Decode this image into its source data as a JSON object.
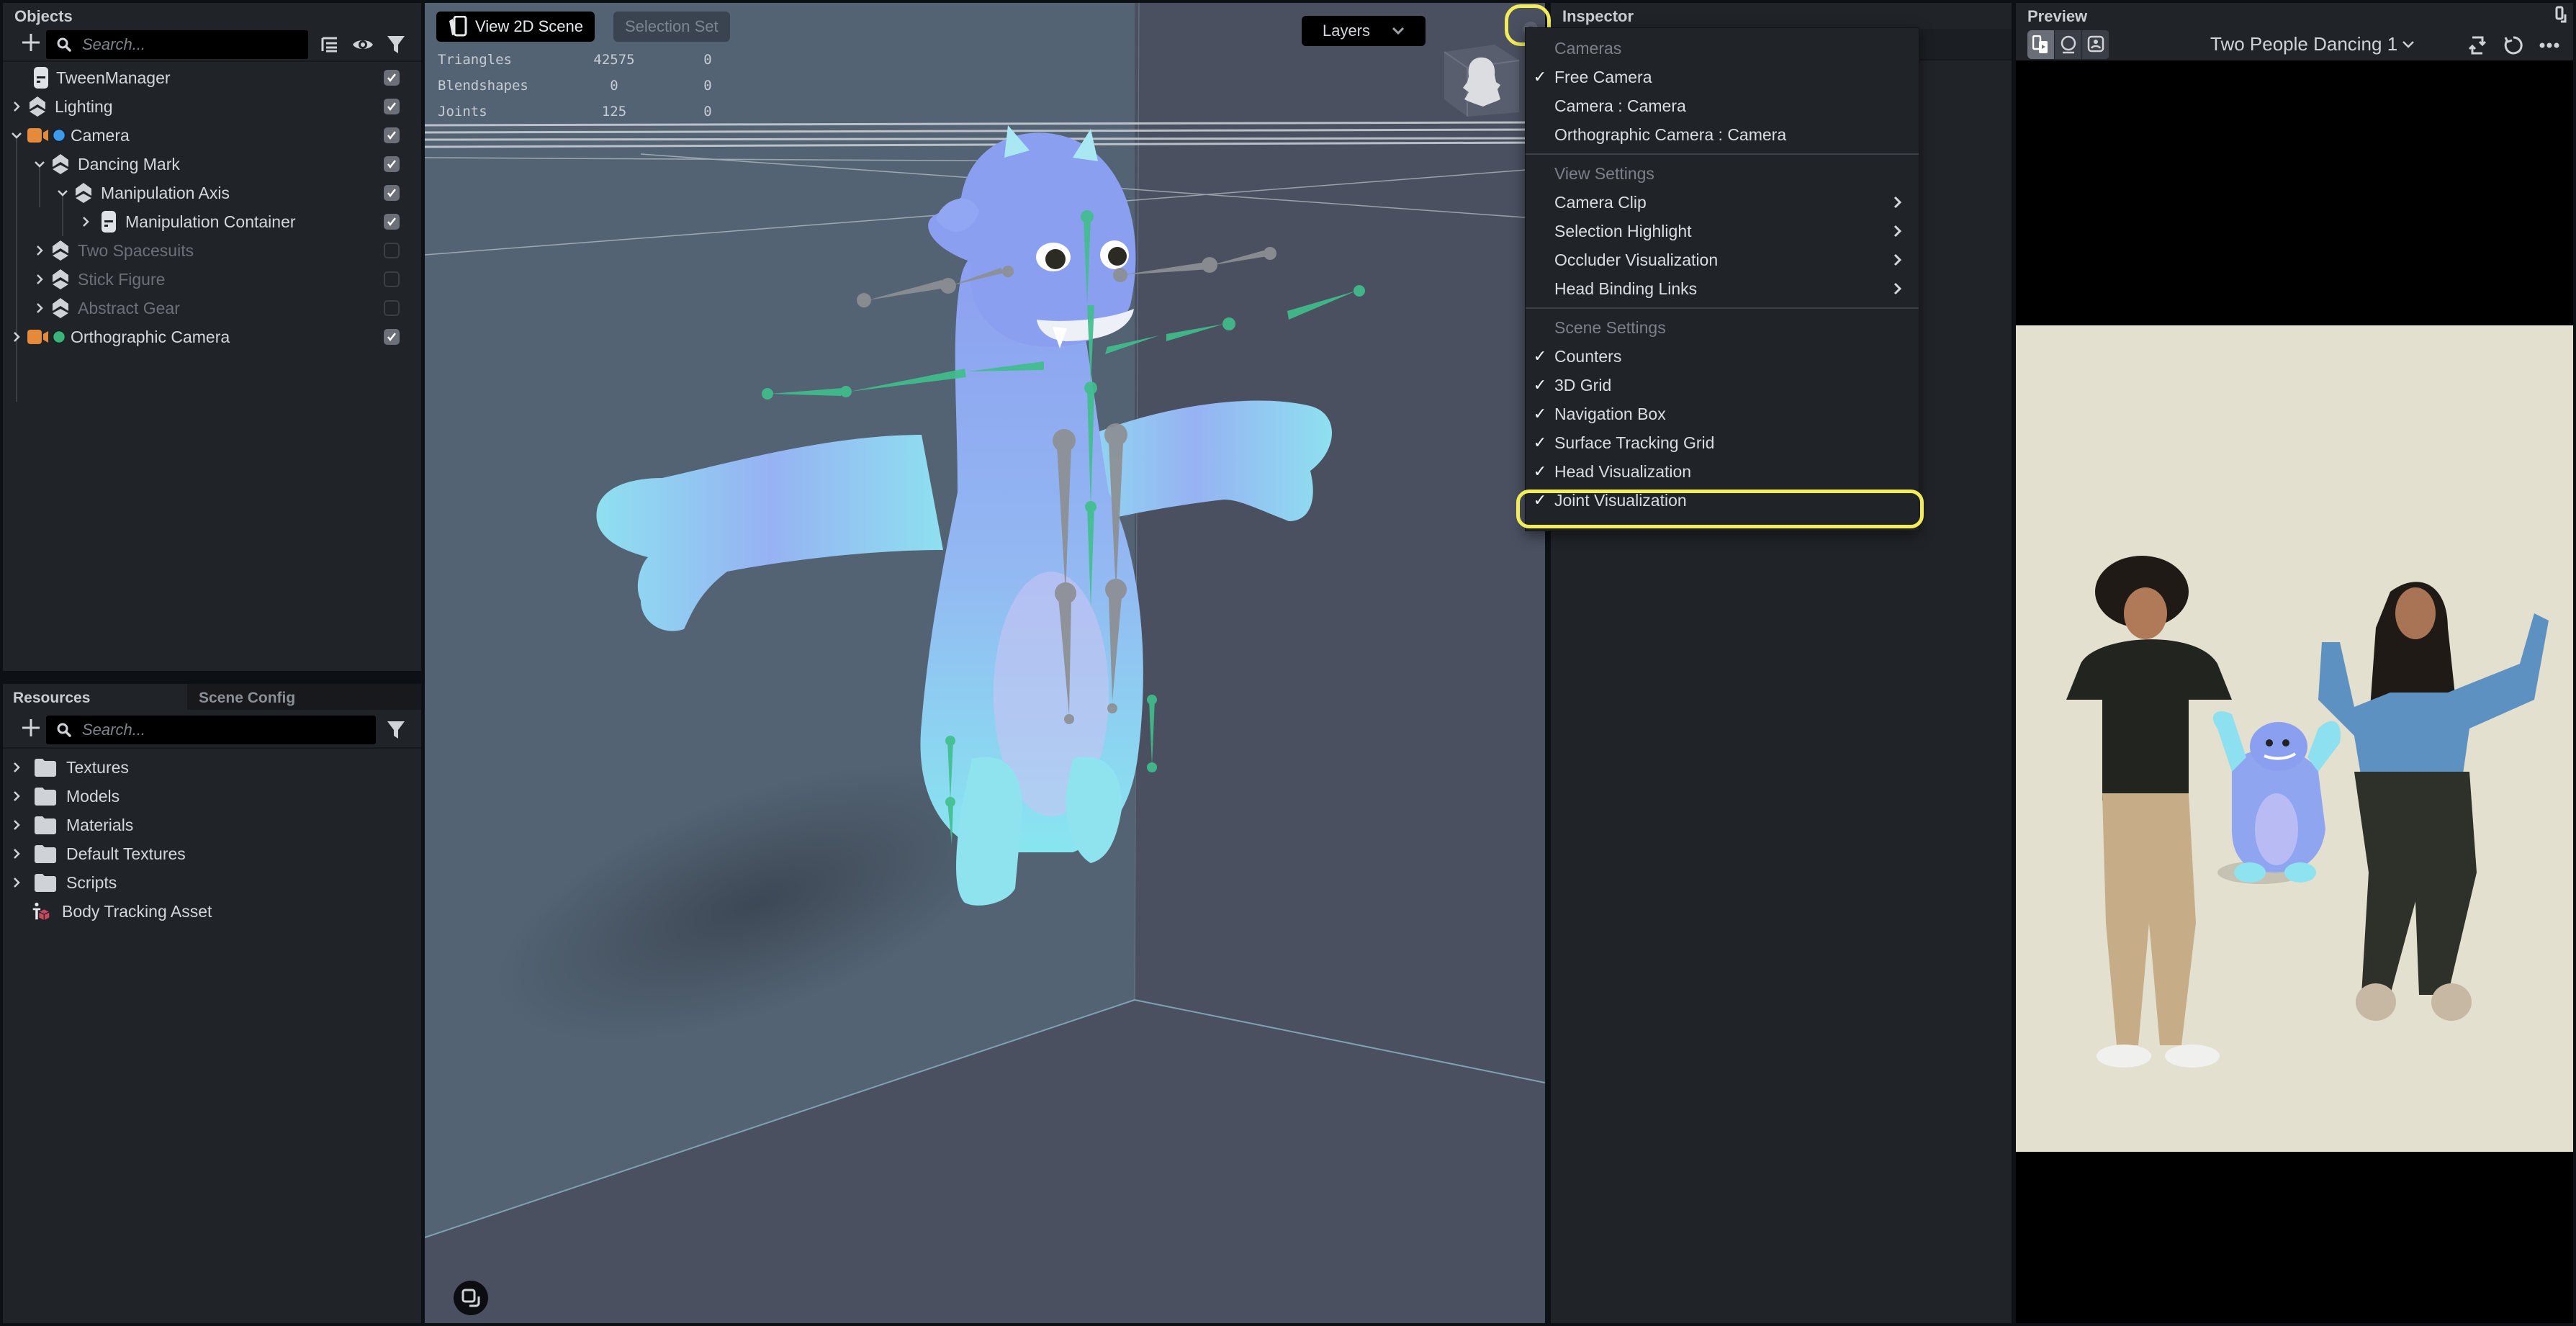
{
  "objects_panel": {
    "title": "Objects",
    "search_placeholder": "Search...",
    "items": [
      {
        "label": "TweenManager",
        "icon": "script-icon",
        "enabled": true,
        "depth": 0,
        "expand": "none"
      },
      {
        "label": "Lighting",
        "icon": "scene-object-icon",
        "enabled": true,
        "depth": 0,
        "expand": "collapsed"
      },
      {
        "label": "Camera",
        "icon": "camera-icon",
        "enabled": true,
        "depth": 0,
        "expand": "expanded",
        "dot_color": "#3d9be9"
      },
      {
        "label": "Dancing Mark",
        "icon": "scene-object-icon",
        "enabled": true,
        "depth": 1,
        "expand": "expanded"
      },
      {
        "label": "Manipulation Axis",
        "icon": "scene-object-icon",
        "enabled": true,
        "depth": 2,
        "expand": "expanded"
      },
      {
        "label": "Manipulation Container",
        "icon": "script-icon",
        "enabled": true,
        "depth": 3,
        "expand": "collapsed"
      },
      {
        "label": "Two Spacesuits",
        "icon": "scene-object-icon",
        "enabled": false,
        "depth": 1,
        "expand": "collapsed"
      },
      {
        "label": "Stick Figure",
        "icon": "scene-object-icon",
        "enabled": false,
        "depth": 1,
        "expand": "collapsed"
      },
      {
        "label": "Abstract Gear",
        "icon": "scene-object-icon",
        "enabled": false,
        "depth": 1,
        "expand": "collapsed"
      },
      {
        "label": "Orthographic Camera",
        "icon": "camera-icon",
        "enabled": true,
        "depth": 0,
        "expand": "collapsed",
        "dot_color": "#3bb37a"
      }
    ]
  },
  "resources_panel": {
    "tabs": [
      "Resources",
      "Scene Config"
    ],
    "active_tab": "Resources",
    "search_placeholder": "Search...",
    "items": [
      {
        "label": "Textures",
        "icon": "folder-icon"
      },
      {
        "label": "Models",
        "icon": "folder-icon"
      },
      {
        "label": "Materials",
        "icon": "folder-icon"
      },
      {
        "label": "Default Textures",
        "icon": "folder-icon"
      },
      {
        "label": "Scripts",
        "icon": "folder-icon"
      },
      {
        "label": "Body Tracking Asset",
        "icon": "body-tracking-icon"
      }
    ]
  },
  "viewport": {
    "view_2d_label": "View 2D Scene",
    "selection_set_label": "Selection Set",
    "layers_label": "Layers",
    "counters": [
      {
        "name": "Triangles",
        "value": "42575",
        "selected": "0"
      },
      {
        "name": "Blendshapes",
        "value": "0",
        "selected": "0"
      },
      {
        "name": "Joints",
        "value": "125",
        "selected": "0"
      }
    ]
  },
  "inspector": {
    "title": "Inspector"
  },
  "scene_menu": {
    "sections": [
      {
        "title": "Cameras",
        "items": [
          {
            "label": "Free Camera",
            "checked": true,
            "submenu": false
          },
          {
            "label": "Camera : Camera",
            "checked": false,
            "submenu": false
          },
          {
            "label": "Orthographic Camera : Camera",
            "checked": false,
            "submenu": false
          }
        ]
      },
      {
        "title": "View Settings",
        "items": [
          {
            "label": "Camera Clip",
            "checked": false,
            "submenu": true
          },
          {
            "label": "Selection Highlight",
            "checked": false,
            "submenu": true
          },
          {
            "label": "Occluder Visualization",
            "checked": false,
            "submenu": true
          },
          {
            "label": "Head Binding Links",
            "checked": false,
            "submenu": true
          }
        ]
      },
      {
        "title": "Scene Settings",
        "items": [
          {
            "label": "Counters",
            "checked": true,
            "submenu": false
          },
          {
            "label": "3D Grid",
            "checked": true,
            "submenu": false
          },
          {
            "label": "Navigation Box",
            "checked": true,
            "submenu": false
          },
          {
            "label": "Surface Tracking Grid",
            "checked": true,
            "submenu": false
          },
          {
            "label": "Head Visualization",
            "checked": true,
            "submenu": false
          },
          {
            "label": "Joint Visualization",
            "checked": true,
            "submenu": false,
            "highlighted": true
          }
        ]
      }
    ],
    "highlight_color": "#f0ec5a"
  },
  "preview": {
    "title": "Preview",
    "device_name": "Two People Dancing 1"
  },
  "colors": {
    "panel_bg": "#202328",
    "app_bg": "#0d1014",
    "viewport_wall": "#536373",
    "viewport_floor": "#4a5060",
    "character_blue": "#8aa7f0",
    "character_cyan": "#8de3ef",
    "joint_green": "#3fbf8c",
    "joint_gray": "#8d8f93",
    "highlight": "#f0ec5a"
  }
}
